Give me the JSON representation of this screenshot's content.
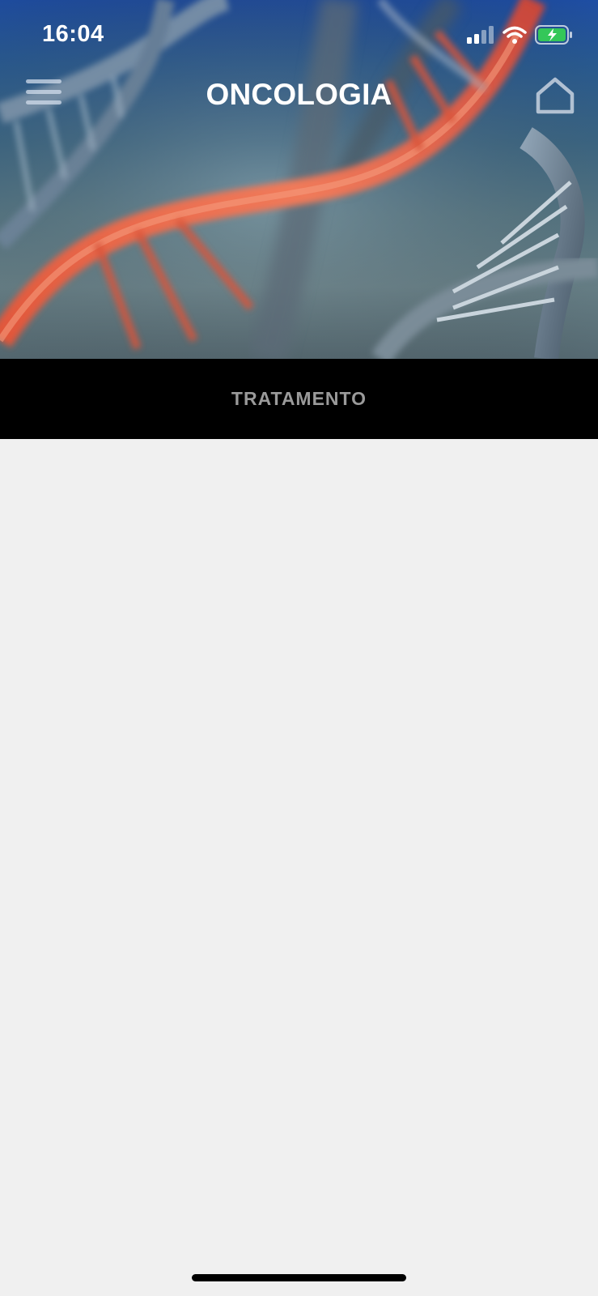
{
  "status_bar": {
    "time": "16:04",
    "icons": [
      "cellular-signal-icon",
      "wifi-icon",
      "battery-charging-icon"
    ]
  },
  "nav": {
    "title": "ONCOLOGIA",
    "menu_icon": "hamburger-menu-icon",
    "home_icon": "home-icon"
  },
  "hero": {
    "image": "dna-double-helix-illustration"
  },
  "section": {
    "label": "TRATAMENTO"
  },
  "colors": {
    "section_bar_bg": "#000000",
    "section_label": "#9a9a9a",
    "content_bg": "#f0f0f0",
    "battery_fill": "#34c759"
  }
}
